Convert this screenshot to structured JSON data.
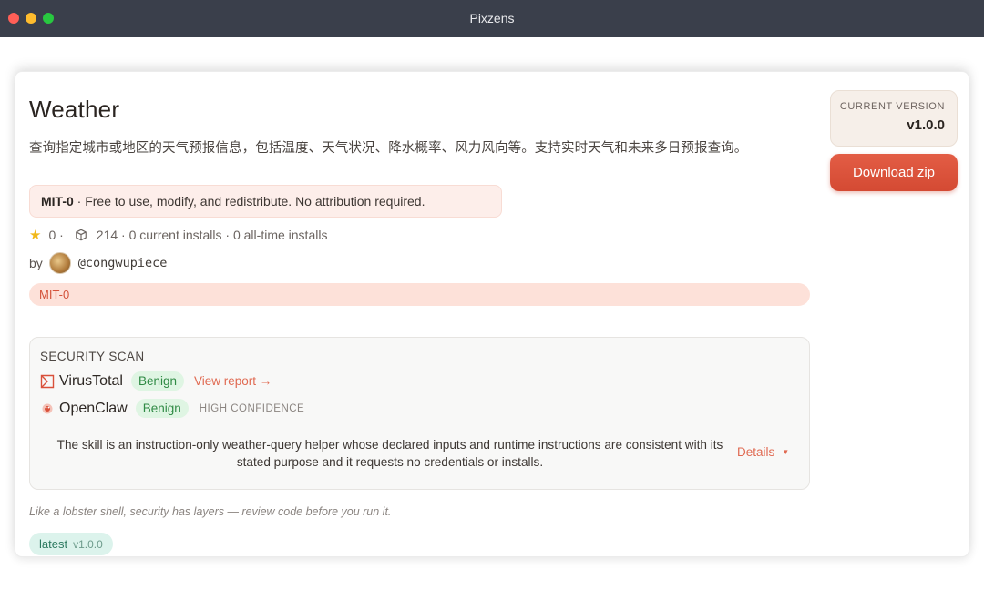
{
  "window": {
    "title": "Pixzens"
  },
  "skill": {
    "name": "Weather",
    "description": "查询指定城市或地区的天气预报信息，包括温度、天气状况、降水概率、风力风向等。支持实时天气和未来多日预报查询。",
    "license_name": "MIT-0",
    "license_text": " · Free to use, modify, and redistribute. No attribution required.",
    "stars": "0 ·",
    "installs": "214 · 0 current installs · 0 all-time installs",
    "by_label": "by",
    "author_handle": "@congwupiece",
    "tag": "MIT-0"
  },
  "security": {
    "title": "SECURITY SCAN",
    "virustotal": {
      "name": "VirusTotal",
      "verdict": "Benign",
      "link": "View report →"
    },
    "openclaw": {
      "name": "OpenClaw",
      "verdict": "Benign",
      "confidence": "HIGH CONFIDENCE"
    },
    "summary": "The skill is an instruction-only weather-query helper whose declared inputs and runtime instructions are consistent with its stated purpose and it requests no credentials or installs.",
    "details_label": "Details"
  },
  "tagline": "Like a lobster shell, security has layers — review code before you run it.",
  "latest": {
    "label": "latest",
    "version": "v1.0.0"
  },
  "sidebar": {
    "version_label": "CURRENT VERSION",
    "version_value": "v1.0.0",
    "download_label": "Download zip"
  },
  "colors": {
    "accent": "#d9503a",
    "benign": "#2f8a44",
    "titlebar": "#3a3f4b"
  }
}
